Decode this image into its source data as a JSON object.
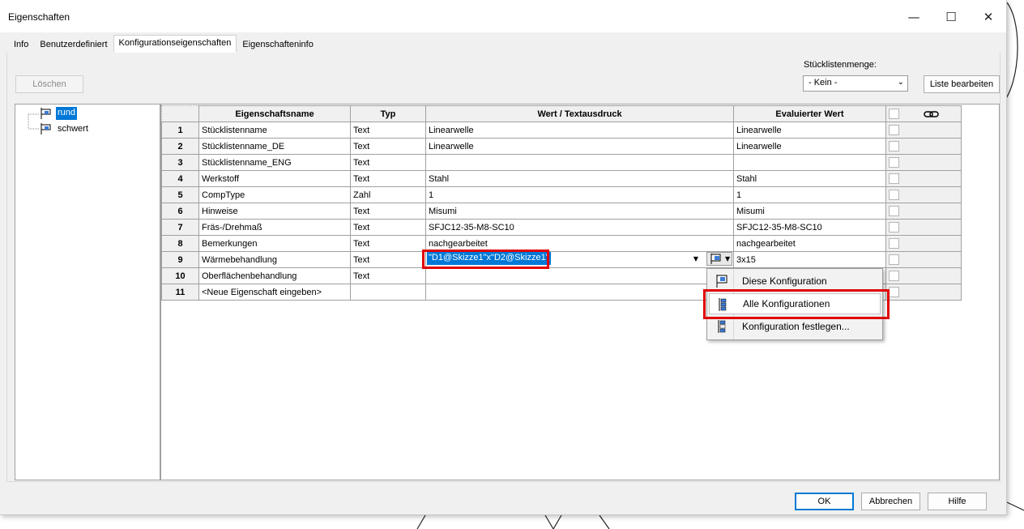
{
  "window": {
    "title": "Eigenschaften",
    "minimize": "—",
    "maximize": "☐",
    "close": "✕"
  },
  "tabs": [
    {
      "label": "Info"
    },
    {
      "label": "Benutzerdefiniert"
    },
    {
      "label": "Konfigurationseigenschaften"
    },
    {
      "label": "Eigenschafteninfo"
    }
  ],
  "toolbar": {
    "delete_label": "Löschen",
    "bom_qty_label": "Stücklistenmenge:",
    "bom_qty_value": "- Kein -",
    "edit_list_label": "Liste bearbeiten"
  },
  "tree": {
    "items": [
      {
        "label": "rund",
        "selected": true
      },
      {
        "label": "schwert",
        "selected": false
      }
    ]
  },
  "grid": {
    "headers": {
      "name": "Eigenschaftsname",
      "type": "Typ",
      "value": "Wert / Textausdruck",
      "evaluated": "Evaluierter Wert"
    },
    "rows": [
      {
        "num": "1",
        "name": "Stücklistenname",
        "type": "Text",
        "value": "Linearwelle",
        "evaluated": "Linearwelle"
      },
      {
        "num": "2",
        "name": "Stücklistenname_DE",
        "type": "Text",
        "value": "Linearwelle",
        "evaluated": "Linearwelle"
      },
      {
        "num": "3",
        "name": "Stücklistenname_ENG",
        "type": "Text",
        "value": "",
        "evaluated": ""
      },
      {
        "num": "4",
        "name": "Werkstoff",
        "type": "Text",
        "value": "Stahl",
        "evaluated": "Stahl"
      },
      {
        "num": "5",
        "name": "CompType",
        "type": "Zahl",
        "value": "1",
        "evaluated": "1"
      },
      {
        "num": "6",
        "name": "Hinweise",
        "type": "Text",
        "value": "Misumi",
        "evaluated": "Misumi"
      },
      {
        "num": "7",
        "name": "Fräs-/Drehmaß",
        "type": "Text",
        "value": "SFJC12-35-M8-SC10",
        "evaluated": "SFJC12-35-M8-SC10"
      },
      {
        "num": "8",
        "name": "Bemerkungen",
        "type": "Text",
        "value": "nachgearbeitet",
        "evaluated": "nachgearbeitet"
      },
      {
        "num": "9",
        "name": "Wärmebehandlung",
        "type": "Text",
        "value": "",
        "evaluated": "3x15"
      },
      {
        "num": "10",
        "name": "Oberflächenbehandlung",
        "type": "Text",
        "value": "",
        "evaluated": ""
      },
      {
        "num": "11",
        "name": "<Neue Eigenschaft eingeben>",
        "type": "",
        "value": "",
        "evaluated": ""
      }
    ],
    "editing_value": "\"D1@Skizze1\"x\"D2@Skizze1\""
  },
  "config_menu": {
    "items": [
      {
        "label": "Diese Konfiguration"
      },
      {
        "label": "Alle Konfigurationen"
      },
      {
        "label": "Konfiguration festlegen..."
      }
    ]
  },
  "footer": {
    "ok": "OK",
    "cancel": "Abbrechen",
    "help": "Hilfe"
  }
}
